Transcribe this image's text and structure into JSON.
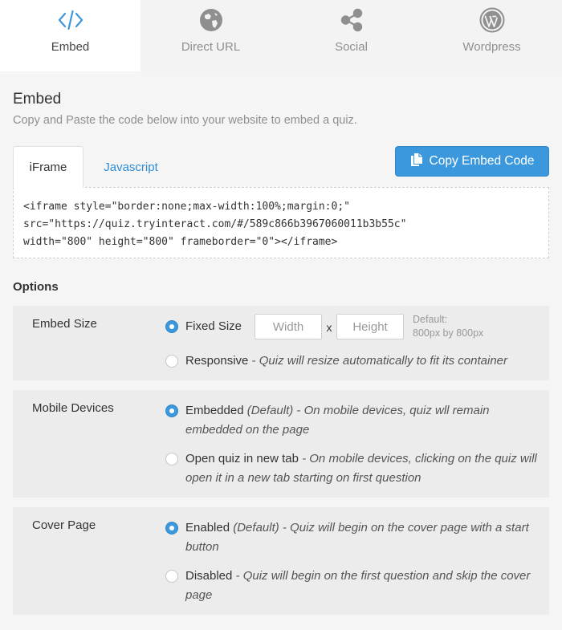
{
  "nav": {
    "tabs": [
      {
        "label": "Embed",
        "icon": "code-icon",
        "active": true
      },
      {
        "label": "Direct URL",
        "icon": "globe-icon",
        "active": false
      },
      {
        "label": "Social",
        "icon": "share-icon",
        "active": false
      },
      {
        "label": "Wordpress",
        "icon": "wordpress-icon",
        "active": false
      }
    ]
  },
  "embed": {
    "title": "Embed",
    "description": "Copy and Paste the code below into your website to embed a quiz.",
    "tabs": [
      "iFrame",
      "Javascript"
    ],
    "active_tab": "iFrame",
    "copy_button": "Copy Embed Code",
    "code_lines": [
      "<iframe style=\"border:none;max-width:100%;margin:0;\"",
      "src=\"https://quiz.tryinteract.com/#/589c866b3967060011b3b55c\"",
      "width=\"800\" height=\"800\" frameborder=\"0\"></iframe>"
    ]
  },
  "options": {
    "title": "Options",
    "embed_size": {
      "label": "Embed Size",
      "fixed_label": "Fixed Size",
      "width_placeholder": "Width",
      "height_placeholder": "Height",
      "separator": "x",
      "default_line1": "Default:",
      "default_line2": "800px by 800px",
      "responsive_label": "Responsive",
      "responsive_desc": " - Quiz will resize automatically to fit its container",
      "selected": "fixed"
    },
    "mobile_devices": {
      "label": "Mobile Devices",
      "embedded_label": "Embedded",
      "embedded_desc": " (Default) - On mobile devices, quiz wll remain embedded on the page",
      "newtab_label": "Open quiz in new tab",
      "newtab_desc": " - On mobile devices, clicking on the quiz will open it in a new tab starting on first question",
      "selected": "embedded"
    },
    "cover_page": {
      "label": "Cover Page",
      "enabled_label": "Enabled",
      "enabled_desc": " (Default) - Quiz will begin on the cover page with a start button",
      "disabled_label": "Disabled",
      "disabled_desc": " - Quiz will begin on the first question and skip the cover page",
      "selected": "enabled"
    }
  },
  "colors": {
    "accent": "#3c98dd",
    "link": "#2f8dd6",
    "icon_inactive": "#8f8f8f"
  }
}
